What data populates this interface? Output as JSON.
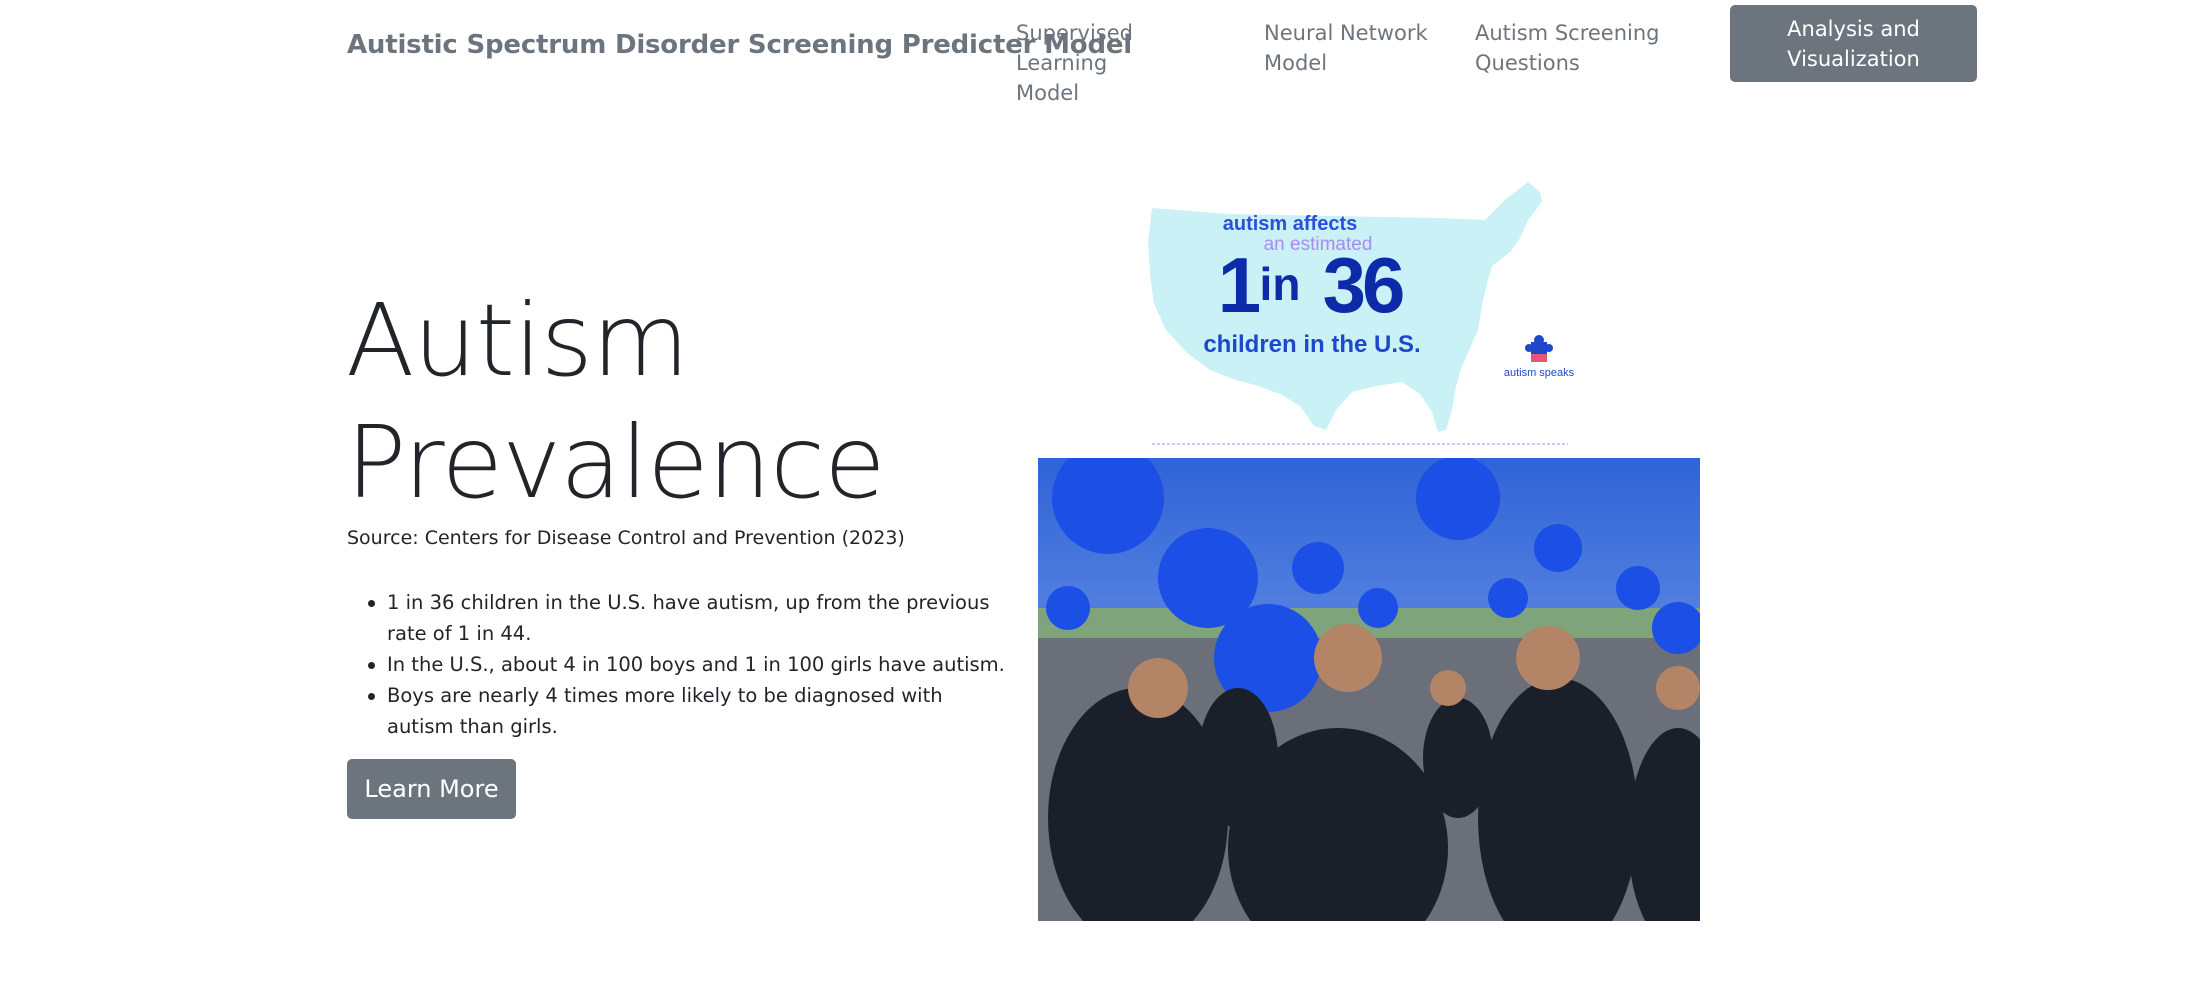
{
  "nav": {
    "brand": "Autistic Spectrum Disorder Screening Predicter Model",
    "links": [
      {
        "label_line1": "Supervised Learning",
        "label_line2": "Model"
      },
      {
        "label_line1": "Neural Network",
        "label_line2": "Model"
      },
      {
        "label_line1": "Autism Screening",
        "label_line2": "Questions"
      }
    ],
    "active_button": {
      "label_line1": "Analysis and",
      "label_line2": "Visualization"
    }
  },
  "hero": {
    "title_line1": "Autism",
    "title_line2": "Prevalence",
    "source": "Source: Centers for Disease Control and Prevention (2023)",
    "facts": [
      "1 in 36 children in the U.S. have autism, up from the previous rate of 1 in 44.",
      "In the U.S., about 4 in 100 boys and 1 in 100 girls have autism.",
      "Boys are nearly 4 times more likely to be diagnosed with autism than girls."
    ],
    "button_label": "Learn More"
  },
  "infographic": {
    "line1": "autism affects",
    "line2": "an estimated",
    "stat_num1": "1",
    "stat_in": "in",
    "stat_num2": "36",
    "line3": "children in the U.S.",
    "logo_text": "autism speaks"
  },
  "colors": {
    "nav_text": "#6c757d",
    "button_bg": "#6c757d",
    "map_fill": "#c9f1f6",
    "stat_blue": "#0d2aa8",
    "accent_purple": "#a98bf2"
  }
}
